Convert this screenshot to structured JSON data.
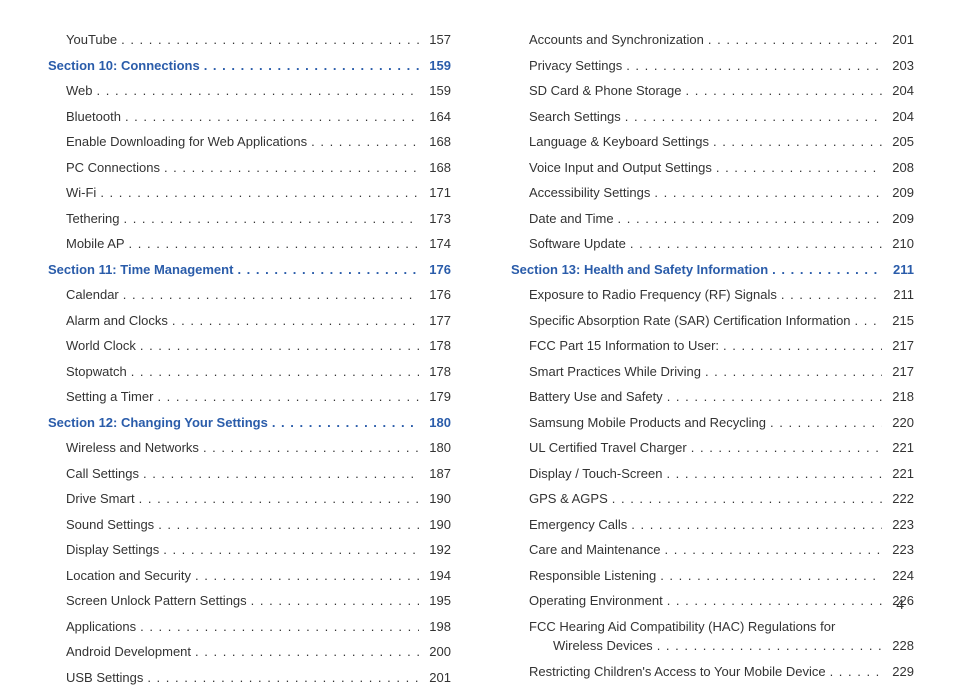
{
  "page_number": "4",
  "left_column": [
    {
      "type": "item",
      "label": "YouTube",
      "page": "157"
    },
    {
      "type": "section",
      "label": "Section 10:  Connections",
      "page": "159"
    },
    {
      "type": "item",
      "label": "Web",
      "page": "159"
    },
    {
      "type": "item",
      "label": "Bluetooth",
      "page": "164"
    },
    {
      "type": "item",
      "label": "Enable Downloading for Web Applications",
      "page": "168"
    },
    {
      "type": "item",
      "label": "PC Connections",
      "page": "168"
    },
    {
      "type": "item",
      "label": "Wi-Fi",
      "page": "171"
    },
    {
      "type": "item",
      "label": "Tethering",
      "page": "173"
    },
    {
      "type": "item",
      "label": "Mobile AP",
      "page": "174"
    },
    {
      "type": "section",
      "label": "Section 11:  Time Management",
      "page": "176"
    },
    {
      "type": "item",
      "label": "Calendar",
      "page": "176"
    },
    {
      "type": "item",
      "label": "Alarm and Clocks",
      "page": "177"
    },
    {
      "type": "item",
      "label": "World Clock",
      "page": "178"
    },
    {
      "type": "item",
      "label": "Stopwatch",
      "page": "178"
    },
    {
      "type": "item",
      "label": "Setting a Timer",
      "page": "179"
    },
    {
      "type": "section",
      "label": "Section 12:  Changing Your Settings",
      "page": "180"
    },
    {
      "type": "item",
      "label": "Wireless and Networks",
      "page": "180"
    },
    {
      "type": "item",
      "label": "Call Settings",
      "page": "187"
    },
    {
      "type": "item",
      "label": "Drive Smart",
      "page": "190"
    },
    {
      "type": "item",
      "label": "Sound Settings",
      "page": "190"
    },
    {
      "type": "item",
      "label": "Display Settings",
      "page": "192"
    },
    {
      "type": "item",
      "label": "Location and Security",
      "page": "194"
    },
    {
      "type": "item",
      "label": "Screen Unlock Pattern Settings",
      "page": "195"
    },
    {
      "type": "item",
      "label": "Applications",
      "page": "198"
    },
    {
      "type": "item",
      "label": "Android Development",
      "page": "200"
    },
    {
      "type": "item",
      "label": "USB Settings",
      "page": "201"
    }
  ],
  "right_column": [
    {
      "type": "item",
      "label": "Accounts and Synchronization",
      "page": "201"
    },
    {
      "type": "item",
      "label": "Privacy Settings",
      "page": "203"
    },
    {
      "type": "item",
      "label": "SD Card & Phone Storage",
      "page": "204"
    },
    {
      "type": "item",
      "label": "Search Settings",
      "page": "204"
    },
    {
      "type": "item",
      "label": "Language & Keyboard Settings",
      "page": "205"
    },
    {
      "type": "item",
      "label": "Voice Input and Output Settings",
      "page": "208"
    },
    {
      "type": "item",
      "label": "Accessibility Settings",
      "page": "209"
    },
    {
      "type": "item",
      "label": "Date and Time",
      "page": "209"
    },
    {
      "type": "item",
      "label": "Software Update",
      "page": "210"
    },
    {
      "type": "section",
      "label": "Section 13:  Health and Safety Information",
      "page": "211"
    },
    {
      "type": "item",
      "label": "Exposure to Radio Frequency (RF) Signals",
      "page": "211"
    },
    {
      "type": "item",
      "label": "Specific Absorption Rate (SAR) Certification Information",
      "page": "215"
    },
    {
      "type": "item",
      "label": "FCC Part 15 Information to User:",
      "page": "217"
    },
    {
      "type": "item",
      "label": "Smart Practices While Driving",
      "page": "217"
    },
    {
      "type": "item",
      "label": "Battery Use and Safety",
      "page": "218"
    },
    {
      "type": "item",
      "label": "Samsung Mobile Products and Recycling",
      "page": "220"
    },
    {
      "type": "item",
      "label": "UL Certified Travel Charger",
      "page": "221"
    },
    {
      "type": "item",
      "label": "Display / Touch-Screen",
      "page": "221"
    },
    {
      "type": "item",
      "label": "GPS & AGPS",
      "page": "222"
    },
    {
      "type": "item",
      "label": "Emergency Calls",
      "page": "223"
    },
    {
      "type": "item",
      "label": "Care and Maintenance",
      "page": "223"
    },
    {
      "type": "item",
      "label": "Responsible Listening",
      "page": "224"
    },
    {
      "type": "item",
      "label": "Operating Environment",
      "page": "226"
    },
    {
      "type": "wrap",
      "line1": "FCC Hearing Aid Compatibility (HAC) Regulations for",
      "line2_label": "Wireless Devices",
      "page": "228"
    },
    {
      "type": "item",
      "label": "Restricting Children's Access to Your Mobile Device",
      "page": "229"
    }
  ]
}
